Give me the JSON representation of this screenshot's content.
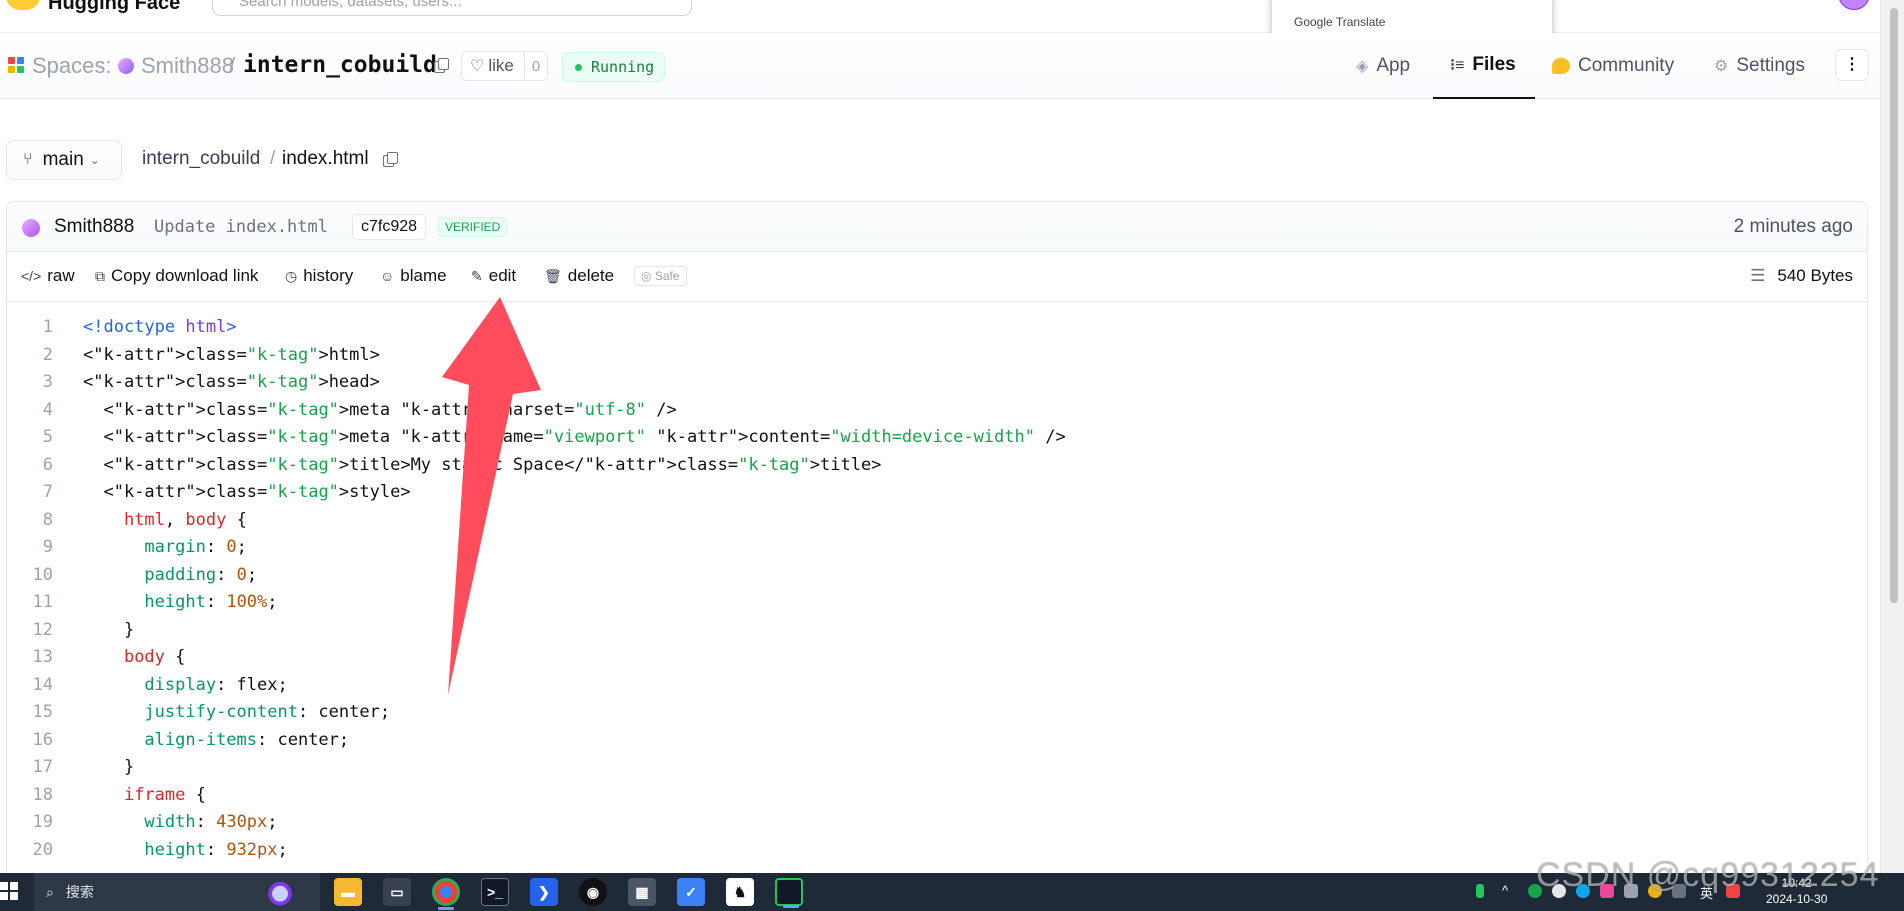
{
  "topbar": {
    "brand": "Hugging Face",
    "search_placeholder": "Search models, datasets, users...",
    "google_translate": "Google Translate"
  },
  "space": {
    "spaces_label": "Spaces:",
    "owner": "Smith888",
    "separator": "/",
    "repo": "intern_cobuild",
    "like_label": "like",
    "like_count": "0",
    "status": "Running",
    "tabs": [
      {
        "label": "App",
        "icon": "cube-icon"
      },
      {
        "label": "Files",
        "icon": "files-icon"
      },
      {
        "label": "Community",
        "icon": "community-icon"
      },
      {
        "label": "Settings",
        "icon": "gear-icon"
      }
    ],
    "more": "⋮"
  },
  "breadcrumb": {
    "branch": "main",
    "repo": "intern_cobuild",
    "sep": "/",
    "file": "index.html"
  },
  "commit": {
    "author": "Smith888",
    "message": "Update index.html",
    "sha": "c7fc928",
    "verified": "VERIFIED",
    "time": "2 minutes ago"
  },
  "actions": {
    "raw": "raw",
    "copy_link": "Copy download link",
    "history": "history",
    "blame": "blame",
    "edit": "edit",
    "delete": "delete",
    "safe": "Safe",
    "size": "540 Bytes"
  },
  "code": {
    "lines": [
      {
        "n": "1",
        "t": "<!doctype html>"
      },
      {
        "n": "2",
        "t": "<html>"
      },
      {
        "n": "3",
        "t": "<head>"
      },
      {
        "n": "4",
        "t": "  <meta charset=\"utf-8\" />"
      },
      {
        "n": "5",
        "t": "  <meta name=\"viewport\" content=\"width=device-width\" />"
      },
      {
        "n": "6",
        "t": "  <title>My static Space</title>"
      },
      {
        "n": "7",
        "t": "  <style>"
      },
      {
        "n": "8",
        "t": "    html, body {"
      },
      {
        "n": "9",
        "t": "      margin: 0;"
      },
      {
        "n": "10",
        "t": "      padding: 0;"
      },
      {
        "n": "11",
        "t": "      height: 100%;"
      },
      {
        "n": "12",
        "t": "    }"
      },
      {
        "n": "13",
        "t": "    body {"
      },
      {
        "n": "14",
        "t": "      display: flex;"
      },
      {
        "n": "15",
        "t": "      justify-content: center;"
      },
      {
        "n": "16",
        "t": "      align-items: center;"
      },
      {
        "n": "17",
        "t": "    }"
      },
      {
        "n": "18",
        "t": "    iframe {"
      },
      {
        "n": "19",
        "t": "      width: 430px;"
      },
      {
        "n": "20",
        "t": "      height: 932px;"
      }
    ]
  },
  "taskbar": {
    "search_label": "搜索",
    "clock_time": "10:42",
    "clock_date": "2024-10-30",
    "ime_lang": "英",
    "watermark": "CSDN @cq99312254"
  }
}
